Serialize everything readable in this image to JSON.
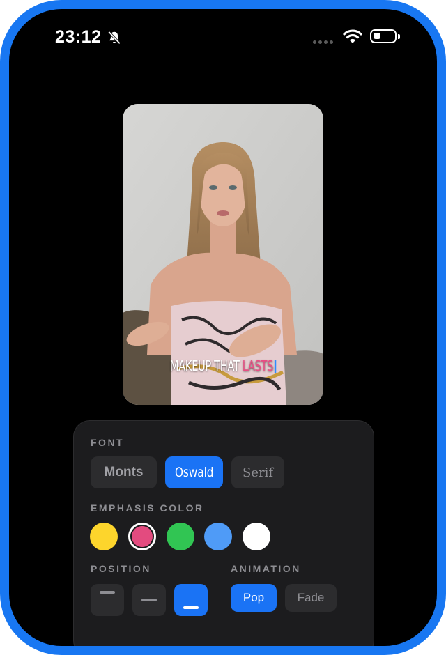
{
  "status_bar": {
    "time": "23:12",
    "icons": [
      "bell-slash-icon",
      "signal-dots-icon",
      "wifi-icon",
      "battery-icon"
    ]
  },
  "video": {
    "caption_normal": "MAKEUP THAT ",
    "caption_emphasis": "LASTS",
    "emphasis_color": "#ea4e84"
  },
  "panel": {
    "font_label": "FONT",
    "font_options": [
      {
        "label": "Monts",
        "selected": false
      },
      {
        "label": "Oswald",
        "selected": true
      },
      {
        "label": "Serif",
        "selected": false
      }
    ],
    "emphasis_label": "EMPHASIS COLOR",
    "emphasis_colors": [
      {
        "name": "yellow",
        "hex": "#fdd52c",
        "selected": false
      },
      {
        "name": "pink",
        "hex": "#e34b7f",
        "selected": true
      },
      {
        "name": "green",
        "hex": "#31c553",
        "selected": false
      },
      {
        "name": "blue",
        "hex": "#4f9bf7",
        "selected": false
      },
      {
        "name": "white",
        "hex": "#ffffff",
        "selected": false
      }
    ],
    "position_label": "POSITION",
    "position_options": [
      {
        "name": "top",
        "selected": false
      },
      {
        "name": "middle",
        "selected": false
      },
      {
        "name": "bottom",
        "selected": true
      }
    ],
    "animation_label": "ANIMATION",
    "animation_options": [
      {
        "label": "Pop",
        "selected": true
      },
      {
        "label": "Fade",
        "selected": false
      }
    ]
  },
  "colors": {
    "accent": "#1a73f5",
    "frame": "#1877f2",
    "panel_bg": "#1c1c1e"
  }
}
